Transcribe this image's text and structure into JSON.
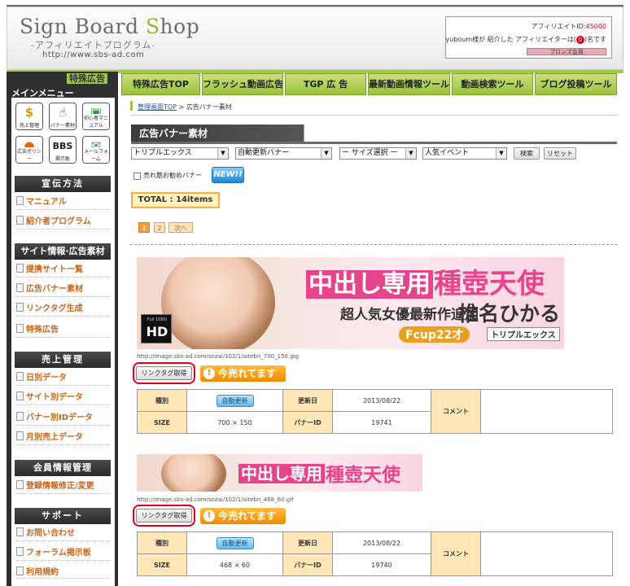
{
  "header": {
    "logo_title_a": "Sign Board ",
    "logo_title_b": "S",
    "logo_title_c": "hop",
    "logo_sub": "-アフィリエイトプログラム-",
    "logo_url": "http://www.sbs-ad.com",
    "affiliate_id_label": "アフィリエイトID:",
    "affiliate_id_value": "45000",
    "intro_text_a": "yuboum様が 紹介した アフィリエイターは(",
    "intro_count": "0",
    "intro_text_b": ")名です",
    "rank_label": "ブロンズ会員"
  },
  "nav": {
    "sidebar_tokubetsu": "特殊広告",
    "sidebar_main_menu": "メインメニュー",
    "tabs": [
      "特殊広告TOP",
      "フラッシュ動画広告",
      "TGP 広 告",
      "最新動画情報ツール",
      "動画検索ツール",
      "ブログ投稿ツール"
    ]
  },
  "sidebar": {
    "icons": [
      {
        "glyph": "$",
        "label": "売上管理"
      },
      {
        "glyph": "☝",
        "label": "バナー素材"
      },
      {
        "glyph": "▣",
        "label": "初心者マニュアル"
      },
      {
        "glyph": "●",
        "label": "広告ポリシー"
      },
      {
        "glyph": "BBS",
        "label": "掲示板"
      },
      {
        "glyph": "✉",
        "label": "メールフォーム"
      }
    ],
    "sections": [
      {
        "title": "宣伝方法",
        "items": [
          "マニュアル",
          "紹介者プログラム"
        ]
      },
      {
        "title": "サイト情報·広告素材",
        "items": [
          "提携サイト一覧",
          "広告バナー素材",
          "リンクタグ生成",
          "特殊広告"
        ]
      },
      {
        "title": "売上管理",
        "items": [
          "日別データ",
          "サイト別データ",
          "バナー別IDデータ",
          "月別売上データ"
        ]
      },
      {
        "title": "会員情報管理",
        "items": [
          "登録情報修正/変更"
        ]
      },
      {
        "title": "サポート",
        "items": [
          "お問い合わせ",
          "フォーラム掲示板",
          "利用規約"
        ]
      }
    ]
  },
  "breadcrumb": {
    "home": "管理画面TOP",
    "sep": " > ",
    "current": "広告バナー素材"
  },
  "page_title": "広告バナー素材",
  "filters": {
    "site": "トリプルエックス",
    "type": "自動更新バナー",
    "size": "ー サイズ選択 ー",
    "event": "人気イベント",
    "search_btn": "検索",
    "reset_btn": "リセット",
    "checkbox_label": "売れ筋お勧めバナー",
    "new_badge": "NEW!!"
  },
  "total": "TOTAL : 14items",
  "pagination": {
    "pages": [
      "1",
      "2"
    ],
    "next": "次へ"
  },
  "banners": [
    {
      "url": "http://image.sbs-ad.com/sozai/102/1/sitebn_700_150.jpg",
      "art_main": "中出し専用",
      "art_title": "種壺天使",
      "art_sub": "超人気女優最新作追加",
      "art_name": "椎名ひかる",
      "art_cup": "Fcup22才",
      "art_brand": "トリプルエックス",
      "art_hd_a": "Full 1080i",
      "art_hd_b": "HD",
      "get_btn": "リンクタグ取得",
      "selling": "今売れてます",
      "info": {
        "type_label": "種別",
        "type_value": "自動更新",
        "size_label": "SIZE",
        "size_value": "700 × 150",
        "updated_label": "更新日",
        "updated_value": "2013/08/22",
        "id_label": "バナーID",
        "id_value": "19741",
        "comment_label": "コメント"
      }
    },
    {
      "url": "http://image.sbs-ad.com/sozai/102/1/sitebn_468_60.gif",
      "art_main": "中出し専用",
      "art_title": "種壺天使",
      "get_btn": "リンクタグ取得",
      "selling": "今売れてます",
      "info": {
        "type_label": "種別",
        "type_value": "自動更新",
        "size_label": "SIZE",
        "size_value": "468 × 60",
        "updated_label": "更新日",
        "updated_value": "2013/08/22",
        "id_label": "バナーID",
        "id_value": "19740",
        "comment_label": "コメント"
      }
    }
  ],
  "colors": {
    "accent_green": "#9fc34a",
    "sidebar_dark": "#2f2f2f",
    "link_orange": "#c8651a",
    "selling_orange": "#f08a00",
    "highlight_red": "#e00018"
  }
}
